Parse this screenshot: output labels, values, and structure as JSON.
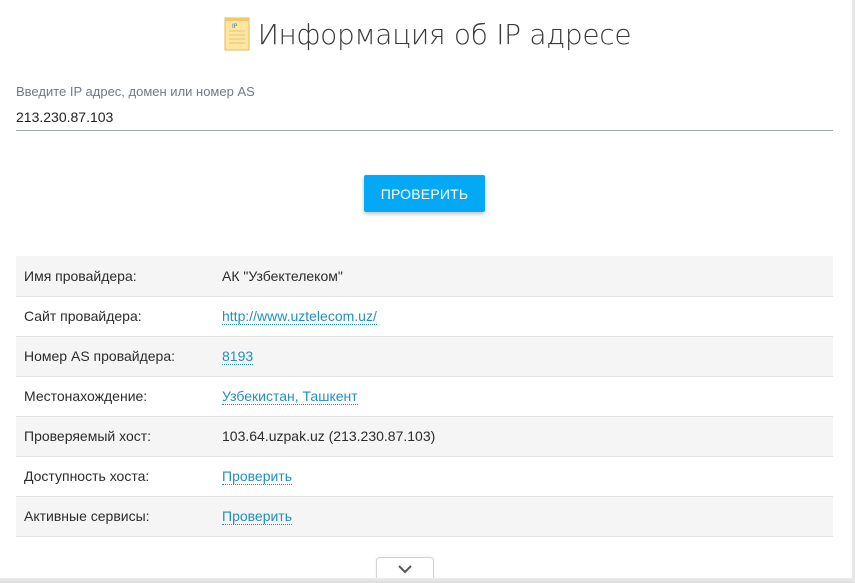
{
  "header": {
    "icon": "ip-document-icon",
    "icon_text": "IP",
    "title": "Информация об IP адресе"
  },
  "search": {
    "label": "Введите IP адрес, домен или номер AS",
    "value": "213.230.87.103"
  },
  "check_button": {
    "label": "ПРОВЕРИТЬ"
  },
  "info_rows": [
    {
      "key": "Имя провайдера:",
      "value": "АК \"Узбектелеком\"",
      "link": false
    },
    {
      "key": "Сайт провайдера:",
      "value": "http://www.uztelecom.uz/",
      "link": true
    },
    {
      "key": "Номер AS провайдера:",
      "value": "8193",
      "link": true
    },
    {
      "key": "Местонахождение:",
      "value": "Узбекистан, Ташкент",
      "link": true
    },
    {
      "key": "Проверяемый хост:",
      "value": "103.64.uzpak.uz (213.230.87.103)",
      "link": false
    },
    {
      "key": "Доступность хоста:",
      "value": "Проверить",
      "link": true
    },
    {
      "key": "Активные сервисы:",
      "value": "Проверить",
      "link": true
    }
  ],
  "expand": {
    "icon": "chevron-down-icon"
  },
  "colors": {
    "accent": "#03a9f4",
    "link": "#1e90c8"
  }
}
